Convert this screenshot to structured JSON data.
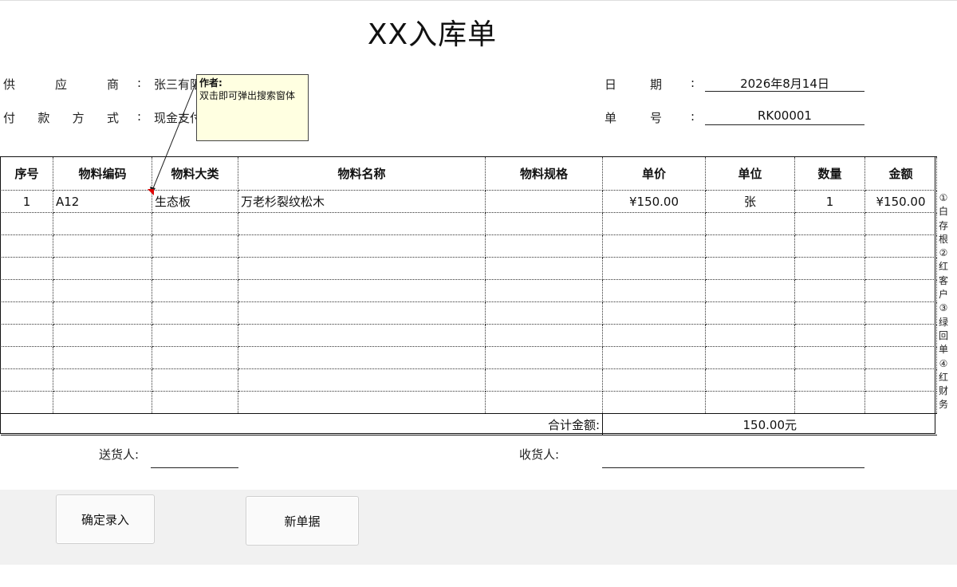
{
  "title": "XX入库单",
  "header": {
    "supplier_label": [
      "供",
      "应",
      "商"
    ],
    "supplier_value": "张三有限公司",
    "payment_label": [
      "付",
      "款",
      "方",
      "式"
    ],
    "payment_value": "现金支付",
    "date_label": [
      "日",
      "期"
    ],
    "date_value": "2026年8月14日",
    "order_label": [
      "单",
      "号"
    ],
    "order_value": "RK00001",
    "colon": ":"
  },
  "comment": {
    "author": "作者:",
    "text": "双击即可弹出搜索窗体"
  },
  "table": {
    "columns": [
      "序号",
      "物料编码",
      "物料大类",
      "物料名称",
      "物料规格",
      "单价",
      "单位",
      "数量",
      "金额"
    ],
    "rows": [
      [
        "1",
        "A12",
        "生态板",
        "万老杉裂纹松木",
        "",
        "¥150.00",
        "张",
        "1",
        "¥150.00"
      ]
    ],
    "total_label": "合计金额:",
    "total_value": "150.00元"
  },
  "side_note": [
    "①",
    "白",
    "存",
    "根",
    "②",
    "红",
    "客",
    "户",
    "③",
    "绿",
    "回",
    "单",
    "④",
    "红",
    "财",
    "务"
  ],
  "signatures": {
    "sender_label": "送货人:",
    "receiver_label": "收货人:"
  },
  "buttons": {
    "confirm": "确定录入",
    "new_doc": "新单据"
  },
  "colors": {
    "comment_bg": "#ffffe1",
    "footer_bg": "#f1f1f1",
    "comment_indicator": "#e00000"
  }
}
